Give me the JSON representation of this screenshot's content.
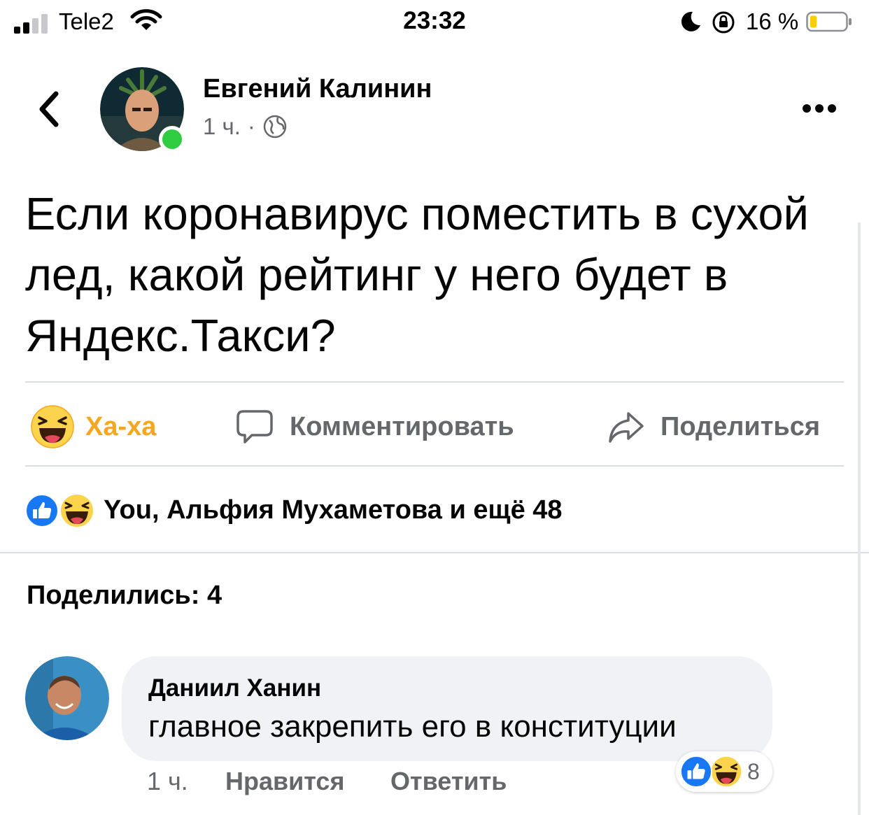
{
  "status_bar": {
    "carrier": "Tele2",
    "time": "23:32",
    "battery_percent": "16 %"
  },
  "post": {
    "author_name": "Евгений Калинин",
    "time": "1 ч.",
    "meta_separator": "·",
    "text": "Если коронавирус поместить в сухой лед, какой рейтинг у него будет в Яндекс.Такси?"
  },
  "actions": {
    "haha_label": "Ха-ха",
    "comment_label": "Комментировать",
    "share_label": "Поделиться"
  },
  "reactions": {
    "summary_text": "You, Альфия Мухаметова и ещё 48"
  },
  "shares": {
    "text": "Поделились: 4"
  },
  "comment": {
    "author": "Даниил Ханин",
    "text": "главное закрепить его в конституции",
    "reaction_count": "8",
    "time": "1 ч.",
    "like_label": "Нравится",
    "reply_label": "Ответить"
  },
  "colors": {
    "haha_yellow": "#f5a623",
    "like_blue": "#1877f2",
    "online_green": "#2ecc40",
    "secondary_text": "#65676b",
    "bubble_bg": "#f0f2f5"
  }
}
